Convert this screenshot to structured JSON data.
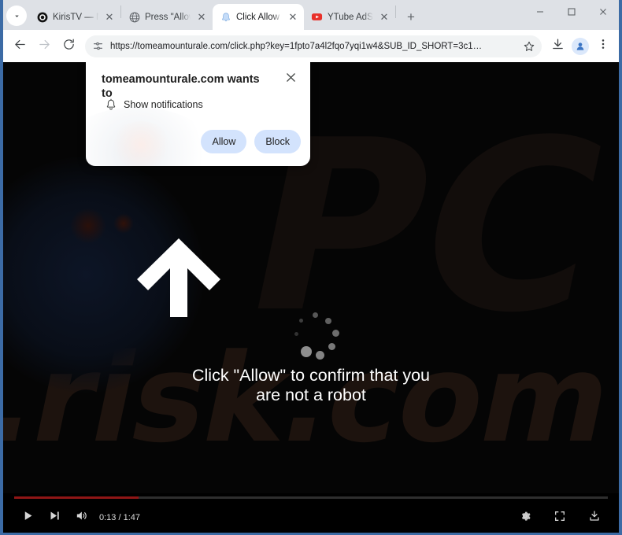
{
  "window": {
    "controls": [
      {
        "name": "minimize",
        "glyph": "–"
      },
      {
        "name": "maximize",
        "glyph": "□"
      },
      {
        "name": "close",
        "glyph": "✕"
      }
    ]
  },
  "tabstrip": {
    "tab_search_label": "Search tabs",
    "new_tab_label": "+",
    "tabs": [
      {
        "title": "KirisTV — Movie",
        "icon": "dark-disc-icon",
        "active": false,
        "close": "✕"
      },
      {
        "title": "Press \"Allow\" to",
        "icon": "globe-icon",
        "active": false,
        "close": "✕"
      },
      {
        "title": "Click Allow",
        "icon": "bell-blue-icon",
        "active": true,
        "close": "✕"
      },
      {
        "title": "YTube AdSkippe",
        "icon": "youtube-icon",
        "active": false,
        "close": "✕"
      }
    ]
  },
  "toolbar": {
    "back_label": "Back",
    "forward_label": "Forward",
    "reload_label": "Reload",
    "site_info_label": "View site information",
    "url": "https://tomeamounturale.com/click.php?key=1fpto7a4l2fqo7yqi1w4&SUB_ID_SHORT=3c1…",
    "bookmark_label": "Bookmark this tab",
    "downloads_label": "Downloads",
    "profile_label": "Profile",
    "menu_label": "Customize and control Google Chrome"
  },
  "permission_dialog": {
    "title": "tomeamounturale.com wants to",
    "close_label": "✕",
    "permission_icon": "bell-icon",
    "permission_text": "Show notifications",
    "allow_label": "Allow",
    "block_label": "Block",
    "button_bg": "#d3e3fd",
    "button_text_color": "#1f1f1f"
  },
  "page": {
    "watermark_top": "PC",
    "watermark_bottom": ".risk.com",
    "arrow_icon": "up-arrow-icon",
    "spinner_icon": "loading-spinner-icon",
    "cta_line1": "Click \"Allow\" to confirm that you",
    "cta_line2": "are not a robot",
    "background_color": "#050505",
    "text_color": "#ffffff"
  },
  "video_controls": {
    "play_label": "Play",
    "next_label": "Next",
    "volume_label": "Mute",
    "time": "0:13 / 1:47",
    "settings_label": "Settings",
    "fullscreen_label": "Full screen",
    "download_label": "Download",
    "progress_percent": 21,
    "progress_color": "#8f1616"
  }
}
